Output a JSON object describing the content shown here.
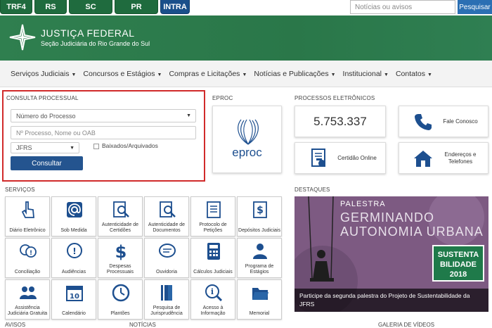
{
  "top_tabs": [
    "TRF4",
    "RS",
    "SC",
    "PR",
    "INTRA"
  ],
  "search": {
    "placeholder": "Notícias ou avisos",
    "button": "Pesquisar"
  },
  "header": {
    "title": "JUSTIÇA FEDERAL",
    "subtitle": "Seção Judiciária do Rio Grande do Sul"
  },
  "nav": [
    "Serviços Judiciais",
    "Concursos e Estágios",
    "Compras e Licitações",
    "Notícias e Publicações",
    "Institucional",
    "Contatos"
  ],
  "consulta": {
    "title": "CONSULTA PROCESSUAL",
    "select_type": "Número do Processo",
    "input_placeholder": "Nº Processo, Nome ou OAB",
    "select_org": "JFRS",
    "checkbox_label": "Baixados/Arquivados",
    "button": "Consultar"
  },
  "eproc": {
    "title": "EPROC",
    "logo_text": "eproc"
  },
  "processos": {
    "title": "PROCESSOS ELETRÔNICOS",
    "count": "5.753.337"
  },
  "quick": [
    {
      "label": "Fale Conosco",
      "icon": "phone-icon"
    },
    {
      "label": "Certidão Online",
      "icon": "certificate-icon"
    },
    {
      "label": "Endereços e Telefones",
      "icon": "house-icon"
    }
  ],
  "servicos": {
    "title": "SERVIÇOS",
    "items": [
      {
        "label": "Diário Eletrônico",
        "icon": "hand-pointer-icon"
      },
      {
        "label": "Sob Medida",
        "icon": "at-sign-icon"
      },
      {
        "label": "Autenticidade de Certidões",
        "icon": "document-search-icon"
      },
      {
        "label": "Autenticidade de Documentos",
        "icon": "document-search-icon"
      },
      {
        "label": "Protocolo de Petições",
        "icon": "document-lines-icon"
      },
      {
        "label": "Depósitos Judiciais",
        "icon": "dollar-document-icon"
      },
      {
        "label": "Conciliação",
        "icon": "speech-bubbles-icon"
      },
      {
        "label": "Audiências",
        "icon": "chat-bubble-icon"
      },
      {
        "label": "Despesas Processuais",
        "icon": "dollar-icon"
      },
      {
        "label": "Ouvidoria",
        "icon": "chat-lines-icon"
      },
      {
        "label": "Cálculos Judiciais",
        "icon": "calculator-icon"
      },
      {
        "label": "Programa de Estágios",
        "icon": "person-icon"
      },
      {
        "label": "Assistência Judiciária Gratuita",
        "icon": "people-icon"
      },
      {
        "label": "Calendário",
        "icon": "calendar-icon"
      },
      {
        "label": "Plantões",
        "icon": "clock-icon"
      },
      {
        "label": "Pesquisa de Jurisprudência",
        "icon": "book-icon"
      },
      {
        "label": "Acesso à Informação",
        "icon": "info-search-icon"
      },
      {
        "label": "Memorial",
        "icon": "folder-icon"
      }
    ]
  },
  "destaques": {
    "title": "DESTAQUES",
    "banner_top": "PALESTRA",
    "banner_line1": "GERMINANDO",
    "banner_line2": "AUTONOMIA URBANA",
    "badge": "SUSTENTA BILIDADE 2018",
    "caption": "Participe da segunda palestra do Projeto de Sustentabilidade da JFRS"
  },
  "footer": {
    "avisos": "AVISOS",
    "noticias": "NOTÍCIAS",
    "galeria": "GALERIA DE VÍDEOS"
  },
  "colors": {
    "green": "#2e7d4d",
    "blue": "#24548f",
    "red_border": "#d12b2b"
  }
}
